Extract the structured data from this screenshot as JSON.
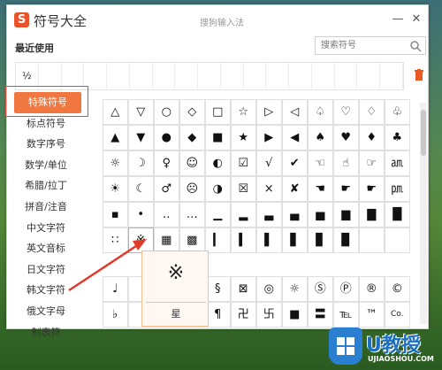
{
  "titlebar": {
    "app_title": "符号大全",
    "ime_title": "搜狗输入法",
    "logo_letter": "S"
  },
  "recent": {
    "label": "最近使用",
    "items": [
      "½",
      "",
      "",
      "",
      "",
      "",
      "",
      "",
      "",
      "",
      "",
      "",
      "",
      "",
      "",
      "",
      ""
    ]
  },
  "search": {
    "placeholder": "搜索符号"
  },
  "sidebar": {
    "items": [
      {
        "label": "特殊符号",
        "active": true
      },
      {
        "label": "标点符号"
      },
      {
        "label": "数字序号"
      },
      {
        "label": "数学/单位"
      },
      {
        "label": "希腊/拉丁"
      },
      {
        "label": "拼音/注音"
      },
      {
        "label": "中文字符"
      },
      {
        "label": "英文音标"
      },
      {
        "label": "日文字符"
      },
      {
        "label": "韩文字符"
      },
      {
        "label": "俄文字母"
      },
      {
        "label": "制表符"
      }
    ]
  },
  "symbols": {
    "rows": [
      [
        "△",
        "▽",
        "○",
        "◇",
        "□",
        "☆",
        "▷",
        "◁",
        "♤",
        "♡",
        "♢",
        "♧"
      ],
      [
        "▲",
        "▼",
        "●",
        "◆",
        "■",
        "★",
        "▶",
        "◀",
        "♠",
        "♥",
        "♦",
        "♣"
      ],
      [
        "☼",
        "☽",
        "♀",
        "☺",
        "◐",
        "☑",
        "√",
        "✔",
        "☜",
        "☝",
        "☞",
        "㏂"
      ],
      [
        "☀",
        "☾",
        "♂",
        "☹",
        "◑",
        "☒",
        "×",
        "✘",
        "☚",
        "☛",
        "☛",
        "㏘"
      ],
      [
        "▪",
        "•",
        "‥",
        "…",
        "▁",
        "▂",
        "▃",
        "▄",
        "▅",
        "▆",
        "▇",
        "█"
      ],
      [
        "∷",
        "※",
        "▦",
        "▩",
        "▎",
        "▍",
        "▌",
        "▋",
        "▊",
        "▉",
        "",
        ""
      ]
    ],
    "rows2": [
      [
        "♩",
        "",
        "",
        "",
        "§",
        "⊠",
        "◎",
        "☼",
        "Ⓢ",
        "Ⓟ",
        "®",
        "©"
      ],
      [
        "♭",
        "",
        "",
        "",
        "¶",
        "卍",
        "卐",
        "■",
        "〓",
        "℡",
        "™",
        "Co."
      ]
    ]
  },
  "tooltip": {
    "symbol": "※",
    "name": "星"
  },
  "watermark": {
    "text": "U教授",
    "url": "UJIAOSHOU.COM"
  },
  "colors": {
    "accent": "#f07840",
    "highlight": "#e04a3a"
  }
}
